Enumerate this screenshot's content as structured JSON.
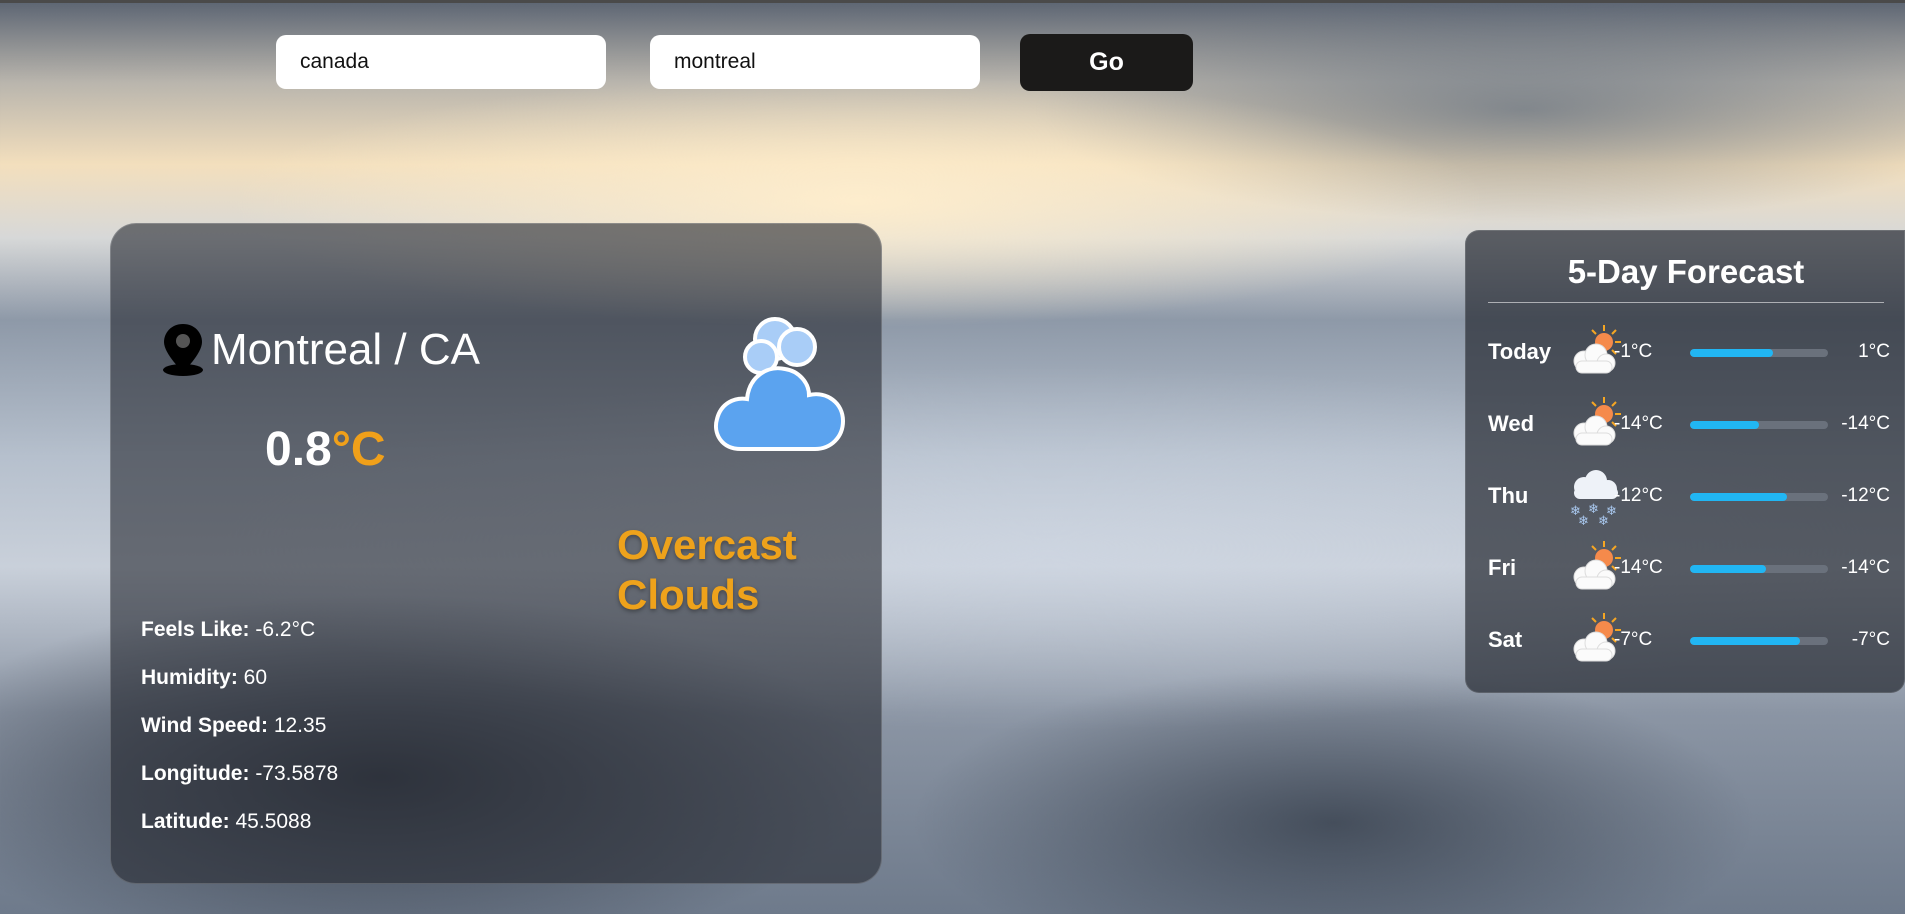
{
  "search": {
    "country_value": "canada",
    "city_value": "montreal",
    "go_label": "Go"
  },
  "current": {
    "location": "Montreal / CA",
    "temp_value": "0.8",
    "temp_unit": "°C",
    "condition_icon": "cloud-icon",
    "description": "Overcast Clouds",
    "details": [
      {
        "label": "Feels Like:",
        "value": "-6.2°C"
      },
      {
        "label": "Humidity:",
        "value": "60"
      },
      {
        "label": "Wind Speed:",
        "value": "12.35"
      },
      {
        "label": "Longitude:",
        "value": "-73.5878"
      },
      {
        "label": "Latitude:",
        "value": "45.5088"
      }
    ]
  },
  "forecast": {
    "title": "5-Day Forecast",
    "days": [
      {
        "day": "Today",
        "icon": "partly-cloudy-icon",
        "low": "-1°C",
        "high": "1°C",
        "bar_fill": 0.6
      },
      {
        "day": "Wed",
        "icon": "partly-cloudy-icon",
        "low": "-14°C",
        "high": "-14°C",
        "bar_fill": 0.5
      },
      {
        "day": "Thu",
        "icon": "snow-icon",
        "low": "-12°C",
        "high": "-12°C",
        "bar_fill": 0.7
      },
      {
        "day": "Fri",
        "icon": "partly-cloudy-icon",
        "low": "-14°C",
        "high": "-14°C",
        "bar_fill": 0.55
      },
      {
        "day": "Sat",
        "icon": "partly-cloudy-icon",
        "low": "-7°C",
        "high": "-7°C",
        "bar_fill": 0.8
      }
    ]
  },
  "colors": {
    "accent": "#eea21b",
    "bar": "#21b6f3",
    "button": "#1b1a19",
    "cloud": "#5ba3ef"
  }
}
